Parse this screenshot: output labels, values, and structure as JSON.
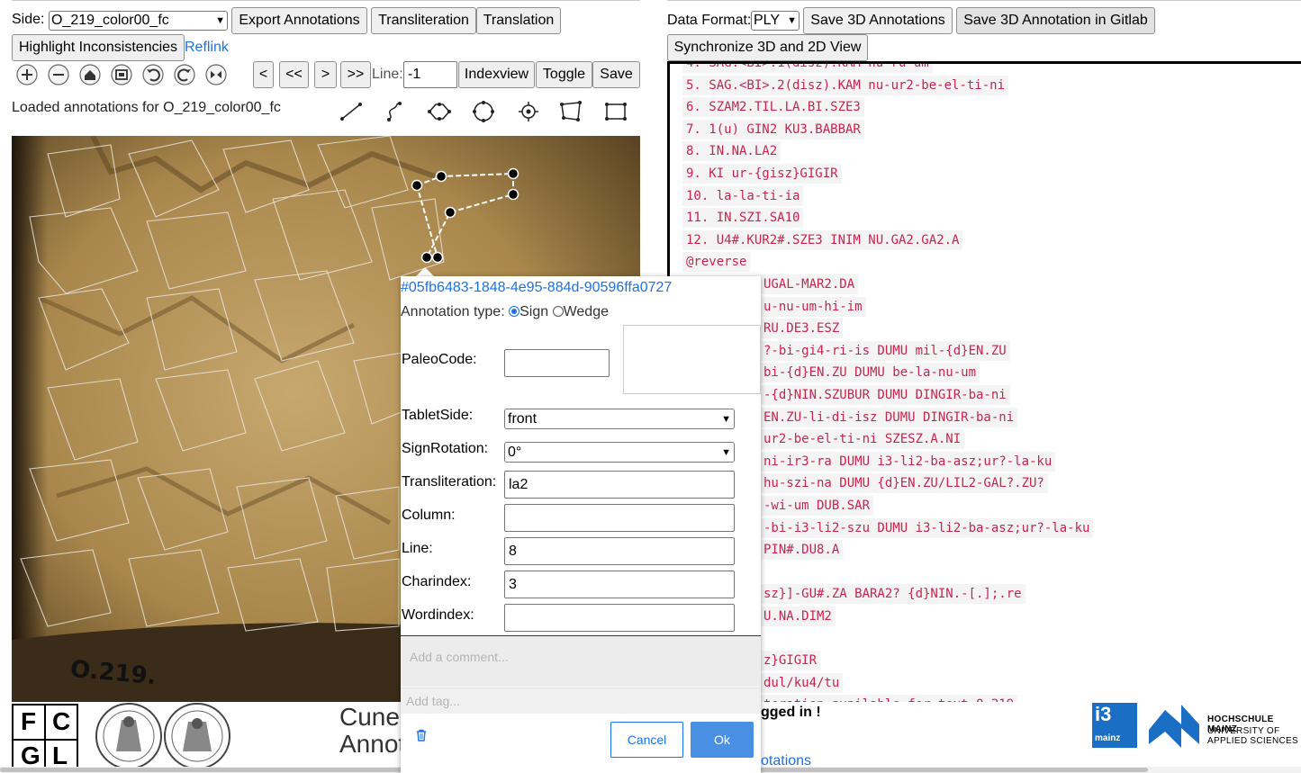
{
  "toolbar": {
    "side_label": "Side:",
    "side_value": "O_219_color00_fc",
    "export_label": "Export Annotations",
    "transliteration_label": "Transliteration",
    "translation_label": "Translation",
    "highlight_label": "Highlight Inconsistencies",
    "reflink_label": "Reflink",
    "prev_label": "<",
    "first_label": "<<",
    "next_label": ">",
    "last_label": ">>",
    "line_label": "Line:",
    "line_value": "-1",
    "indexview_label": "Indexview",
    "toggle_label": "Toggle",
    "save_label": "Save",
    "status_text": "Loaded annotations for O_219_color00_fc"
  },
  "viewer_icons": [
    "zoom-in-icon",
    "zoom-out-icon",
    "home-icon",
    "fullpage-icon",
    "rotate-left-icon",
    "rotate-right-icon",
    "flip-icon"
  ],
  "draw_tools": [
    "polyline-tool-icon",
    "freehand-tool-icon",
    "polygon-tool-icon",
    "circle-tool-icon",
    "point-tool-icon",
    "quad-tool-icon",
    "rectangle-tool-icon"
  ],
  "image": {
    "tablet_label": "O.219."
  },
  "popup": {
    "id_link": "#05fb6483-1848-4e95-884d-90596ffa0727",
    "annotation_type_label": "Annotation type:",
    "type_sign": "Sign",
    "type_wedge": "Wedge",
    "paleocode_label": "PaleoCode:",
    "tabletside_label": "TabletSide:",
    "tabletside_value": "front",
    "signrotation_label": "SignRotation:",
    "signrotation_value": "0°",
    "transliteration_label": "Transliteration:",
    "transliteration_value": "la2",
    "column_label": "Column:",
    "column_value": "",
    "line_label": "Line:",
    "line_value": "8",
    "charindex_label": "Charindex:",
    "charindex_value": "3",
    "wordindex_label": "Wordindex:",
    "wordindex_value": "",
    "comment_placeholder": "Add a comment...",
    "tag_placeholder": "Add tag...",
    "cancel_label": "Cancel",
    "ok_label": "Ok"
  },
  "right": {
    "format_label": "Data Format:",
    "format_value": "PLY",
    "save3d_label": "Save 3D Annotations",
    "save3d_gitlab_label": "Save 3D Annotation in Gitlab",
    "sync_label": "Synchronize 3D and 2D View",
    "text_lines": [
      "4. SAG.<BI>.1(disz).KAM nu-ru-um",
      "5. SAG.<BI>.2(disz).KAM nu-ur2-be-el-ti-ni",
      "6. SZAM2.TIL.LA.BI.SZE3",
      "7. 1(u) GIN2 KU3.BABBAR",
      "8. IN.NA.LA2",
      "9. KI ur-{gisz}GIGIR",
      "10. la-la-ti-ia",
      "11. IN.SZI.SA10",
      "12. U4#.KUR2#.SZE3 INIM NU.GA2.GA2.A",
      "@reverse",
      "UGAL-MAR2.DA",
      "u-nu-um-hi-im",
      "RU.DE3.ESZ",
      "?-bi-gi4-ri-is DUMU mil-{d}EN.ZU",
      "bi-{d}EN.ZU DUMU be-la-nu-um",
      "-{d}NIN.SZUBUR DUMU DINGIR-ba-ni",
      "EN.ZU-li-di-isz DUMU DINGIR-ba-ni",
      "ur2-be-el-ti-ni SZESZ.A.NI",
      "ni-ir3-ra DUMU i3-li2-ba-asz;ur?-la-ku",
      "hu-szi-na DUMU {d}EN.ZU/LIL2-GAL?.ZU?",
      "-wi-um DUB.SAR",
      "-bi-i3-li2-szu DUMU i3-li2-ba-asz;ur?-la-ku",
      "PIN#.DU8.A",
      "",
      "sz}]-GU#.ZA BARA2? {d}NIN.-[.];.re",
      "U.NA.DIM2",
      "",
      "z}GIGIR",
      "dul/ku4/tu",
      "teration available for text O.219"
    ],
    "login_text": "gged in !",
    "annotations_link": "otations"
  },
  "footer": {
    "fcgl": [
      "F",
      "C",
      "G",
      "L"
    ],
    "title_1": "Cune",
    "title_2": "Annot",
    "i3_logo": "i3",
    "i3_sub": "mainz",
    "hs_1": "HOCHSCHULE MAINZ",
    "hs_2": "UNIVERSITY OF",
    "hs_3": "APPLIED SCIENCES"
  }
}
